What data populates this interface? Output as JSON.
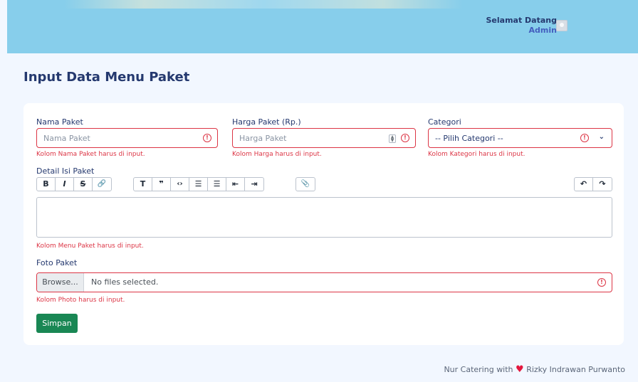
{
  "header": {
    "greeting": "Selamat Datang",
    "role": "Admin",
    "bg_color": "#87ceeb"
  },
  "page": {
    "title": "Input Data Menu Paket"
  },
  "form": {
    "nama_paket": {
      "label": "Nama Paket",
      "placeholder": "Nama Paket",
      "error": "Kolom Nama Paket harus di input."
    },
    "harga_paket": {
      "label": "Harga Paket (Rp.)",
      "placeholder": "Harga Paket",
      "error": "Kolom Harga harus di input."
    },
    "categori": {
      "label": "Categori",
      "selected": "-- Pilih Categori --",
      "error": "Kolom Kategori harus di input."
    },
    "detail": {
      "label": "Detail Isi Paket",
      "error": "Kolom Menu Paket harus di input.",
      "toolbar": {
        "bold": "B",
        "italic": "I",
        "strike": "S",
        "link": "🔗",
        "heading": "T",
        "quote": "❞",
        "code": "‹›",
        "bullet_list": "☰",
        "number_list": "☰",
        "outdent": "⇤",
        "indent": "⇥",
        "attach": "📎",
        "undo": "↶",
        "redo": "↷"
      }
    },
    "foto": {
      "label": "Foto Paket",
      "browse": "Browse...",
      "file_status": "No files selected.",
      "error": "Kolom Photo harus di input."
    },
    "submit": "Simpan"
  },
  "footer": {
    "text_before": "Nur Catering with",
    "text_after": "Rizky Indrawan Purwanto"
  },
  "colors": {
    "error": "#dc3545",
    "primary_text": "#25396f",
    "submit": "#198754",
    "heart": "#e3173e"
  }
}
